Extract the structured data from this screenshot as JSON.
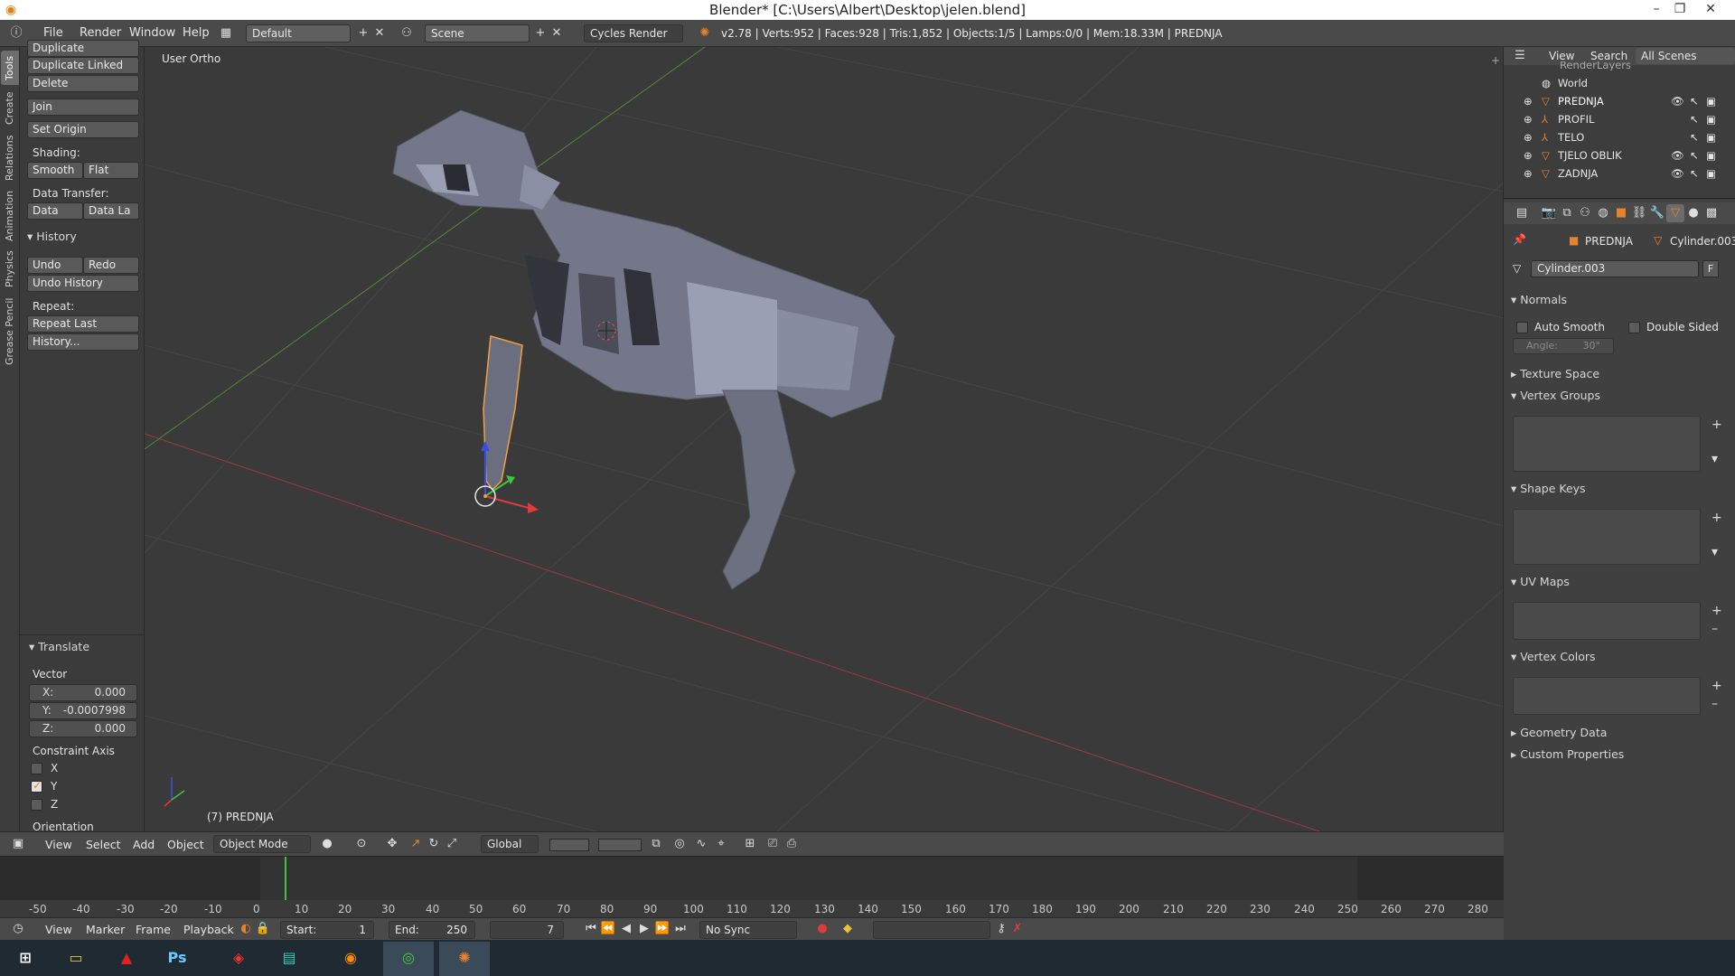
{
  "window": {
    "title": "Blender* [C:\\Users\\Albert\\Desktop\\jelen.blend]"
  },
  "infobar": {
    "menus": [
      "File",
      "Render",
      "Window",
      "Help"
    ],
    "layout": "Default",
    "scene": "Scene",
    "engine": "Cycles Render",
    "stats": "v2.78 | Verts:952 | Faces:928 | Tris:1,852 | Objects:1/5 | Lamps:0/0 | Mem:18.33M | PREDNJA"
  },
  "tabs": [
    "Tools",
    "Create",
    "Relations",
    "Animation",
    "Physics",
    "Grease Pencil"
  ],
  "toolshelf": {
    "duplicate": "Duplicate",
    "duplicate_linked": "Duplicate Linked",
    "delete": "Delete",
    "join": "Join",
    "set_origin": "Set Origin",
    "shading_label": "Shading:",
    "smooth": "Smooth",
    "flat": "Flat",
    "data_transfer_label": "Data Transfer:",
    "data": "Data",
    "data_la": "Data La",
    "history_header": "History",
    "undo": "Undo",
    "redo": "Redo",
    "undo_history": "Undo History",
    "repeat_label": "Repeat:",
    "repeat_last": "Repeat Last",
    "history_btn": "History..."
  },
  "operator": {
    "header": "Translate",
    "vector_label": "Vector",
    "x_label": "X:",
    "x_value": "0.000",
    "y_label": "Y:",
    "y_value": "-0.0007998",
    "z_label": "Z:",
    "z_value": "0.000",
    "constraint_label": "Constraint Axis",
    "cx": "X",
    "cy": "Y",
    "cz": "Z",
    "orientation_label": "Orientation"
  },
  "viewport": {
    "view_label": "User Ortho",
    "object_label": "(7) PREDNJA"
  },
  "v3dheader": {
    "view": "View",
    "select": "Select",
    "add": "Add",
    "object": "Object",
    "mode": "Object Mode",
    "orientation": "Global"
  },
  "timeline": {
    "ticks": [
      "-50",
      "-40",
      "-30",
      "-20",
      "-10",
      "0",
      "10",
      "20",
      "30",
      "40",
      "50",
      "60",
      "70",
      "80",
      "90",
      "100",
      "110",
      "120",
      "130",
      "140",
      "150",
      "160",
      "170",
      "180",
      "190",
      "200",
      "210",
      "220",
      "230",
      "240",
      "250",
      "260",
      "270",
      "280"
    ],
    "view": "View",
    "marker": "Marker",
    "frame": "Frame",
    "playback": "Playback",
    "start_label": "Start:",
    "start_value": "1",
    "end_label": "End:",
    "end_value": "250",
    "current": "7",
    "sync": "No Sync"
  },
  "outliner": {
    "view": "View",
    "search": "Search",
    "scope": "All Scenes",
    "cut_row": "RenderLayers",
    "world": "World",
    "objects": [
      "PREDNJA",
      "PROFIL",
      "TELO",
      "TJELO OBLIK",
      "ZADNJA"
    ]
  },
  "properties": {
    "object_crumb": "PREDNJA",
    "mesh_crumb": "Cylinder.003",
    "mesh_name": "Cylinder.003",
    "fake_user": "F",
    "normals": "Normals",
    "auto_smooth": "Auto Smooth",
    "double_sided": "Double Sided",
    "angle_label": "Angle:",
    "angle_value": "30°",
    "texture_space": "Texture Space",
    "vertex_groups": "Vertex Groups",
    "shape_keys": "Shape Keys",
    "uv_maps": "UV Maps",
    "vertex_colors": "Vertex Colors",
    "geometry_data": "Geometry Data",
    "custom_properties": "Custom Properties"
  },
  "taskbar": {
    "apps": [
      "start-icon",
      "file-explorer-icon",
      "acrobat-icon",
      "photoshop-icon",
      "sketchup-icon",
      "app-icon",
      "firefox-icon",
      "chrome-icon",
      "blender-icon"
    ]
  },
  "colors": {
    "accent": "#e8832b",
    "header": "#4a4a4a",
    "viewport": "#3a3a3a",
    "panel": "#3b3b3b",
    "active_object": "#f0a040"
  }
}
